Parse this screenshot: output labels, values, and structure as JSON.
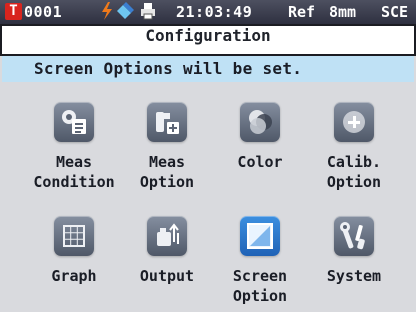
{
  "status": {
    "badge": "T",
    "channel": "0001",
    "time": "21:03:49",
    "ref": "Ref",
    "aperture": "8mm",
    "mode": "SCE",
    "icons": [
      "flash-icon",
      "probe-icon",
      "printer-icon"
    ]
  },
  "title": "Configuration",
  "message": "Screen Options will be set.",
  "menu": [
    {
      "line1": "Meas",
      "line2": "Condition",
      "icon": "meas-condition-icon"
    },
    {
      "line1": "Meas",
      "line2": "Option",
      "icon": "meas-option-icon"
    },
    {
      "line1": "Color",
      "line2": "",
      "icon": "color-icon"
    },
    {
      "line1": "Calib.",
      "line2": "Option",
      "icon": "calib-option-icon"
    },
    {
      "line1": "Graph",
      "line2": "",
      "icon": "graph-icon"
    },
    {
      "line1": "Output",
      "line2": "",
      "icon": "output-icon"
    },
    {
      "line1": "Screen",
      "line2": "Option",
      "icon": "screen-option-icon"
    },
    {
      "line1": "System",
      "line2": "",
      "icon": "system-icon"
    }
  ],
  "colors": {
    "header": "#2e3040",
    "badge": "#d8241e",
    "message_bg": "#bfe1f5",
    "background": "#d9dade",
    "selected_icon": "#1f62b6"
  }
}
